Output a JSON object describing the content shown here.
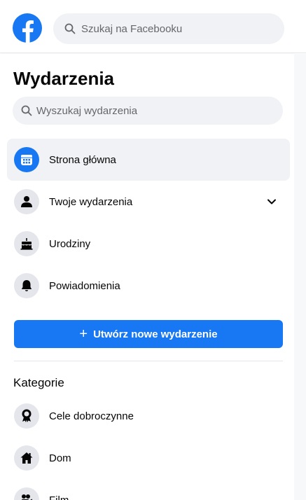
{
  "header": {
    "search_placeholder": "Szukaj na Facebooku"
  },
  "page": {
    "title": "Wydarzenia",
    "search_placeholder": "Wyszukaj wydarzenia"
  },
  "menu": {
    "home": "Strona główna",
    "your_events": "Twoje wydarzenia",
    "birthdays": "Urodziny",
    "notifications": "Powiadomienia"
  },
  "create_button": {
    "plus": "+",
    "label": "Utwórz nowe wydarzenie"
  },
  "categories": {
    "title": "Kategorie",
    "charity": "Cele dobroczynne",
    "home": "Dom",
    "film": "Film"
  },
  "colors": {
    "brand_blue": "#1877f2",
    "active_bg": "#f0f2f5",
    "icon_bg": "#e4e6eb"
  }
}
